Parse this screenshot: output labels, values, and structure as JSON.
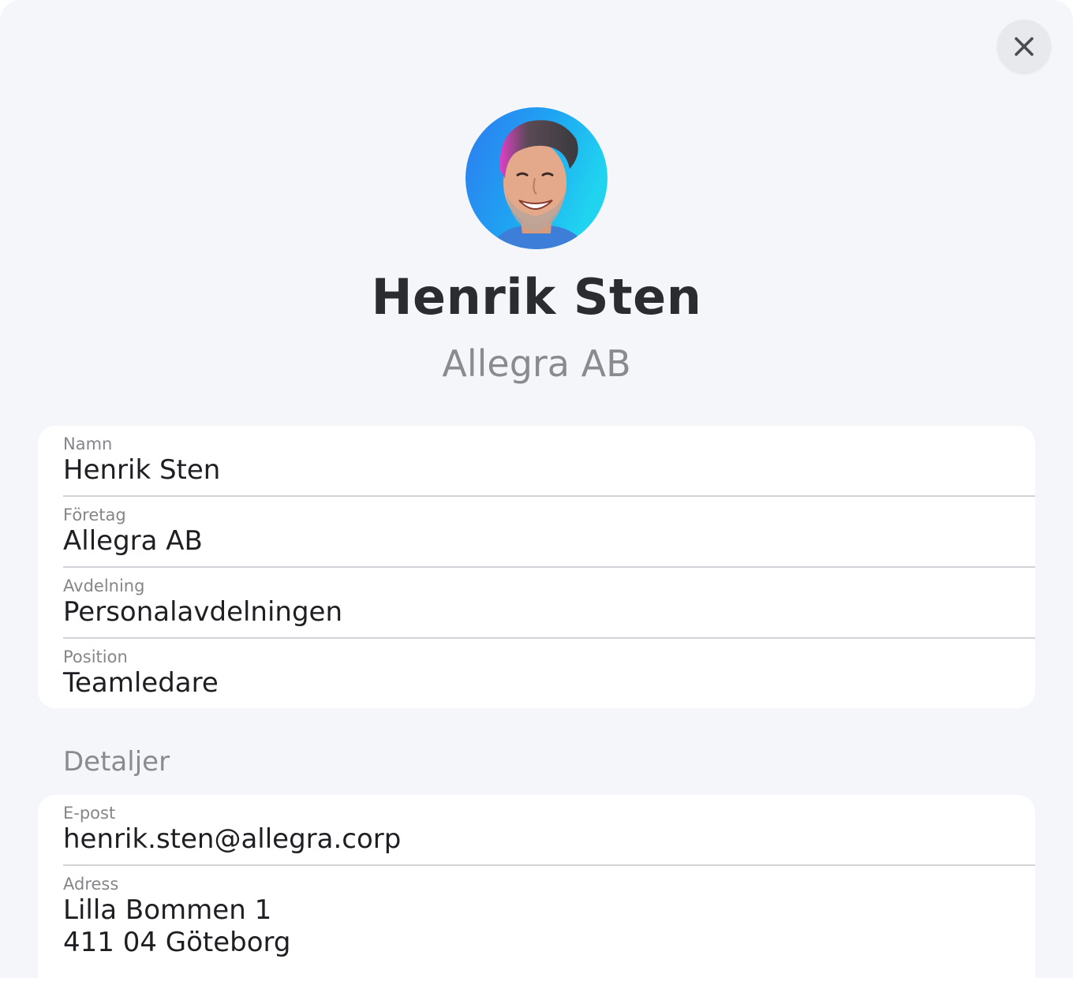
{
  "header": {
    "name": "Henrik Sten",
    "company": "Allegra AB",
    "close_icon": "close-icon",
    "avatar": "avatar-photo"
  },
  "fields": [
    {
      "label": "Namn",
      "value": "Henrik Sten"
    },
    {
      "label": "Företag",
      "value": "Allegra AB"
    },
    {
      "label": "Avdelning",
      "value": "Personalavdelningen"
    },
    {
      "label": "Position",
      "value": "Teamledare"
    }
  ],
  "details": {
    "heading": "Detaljer",
    "fields": [
      {
        "label": "E-post",
        "value": "henrik.sten@allegra.corp"
      },
      {
        "label": "Adress",
        "line1": "Lilla Bommen 1",
        "line2": "411 04 Göteborg"
      }
    ]
  },
  "colors": {
    "background": "#f4f6f9",
    "card": "#ffffff",
    "title": "#2b2c30",
    "muted": "#8a8b8f",
    "divider": "#d2d3d6"
  }
}
